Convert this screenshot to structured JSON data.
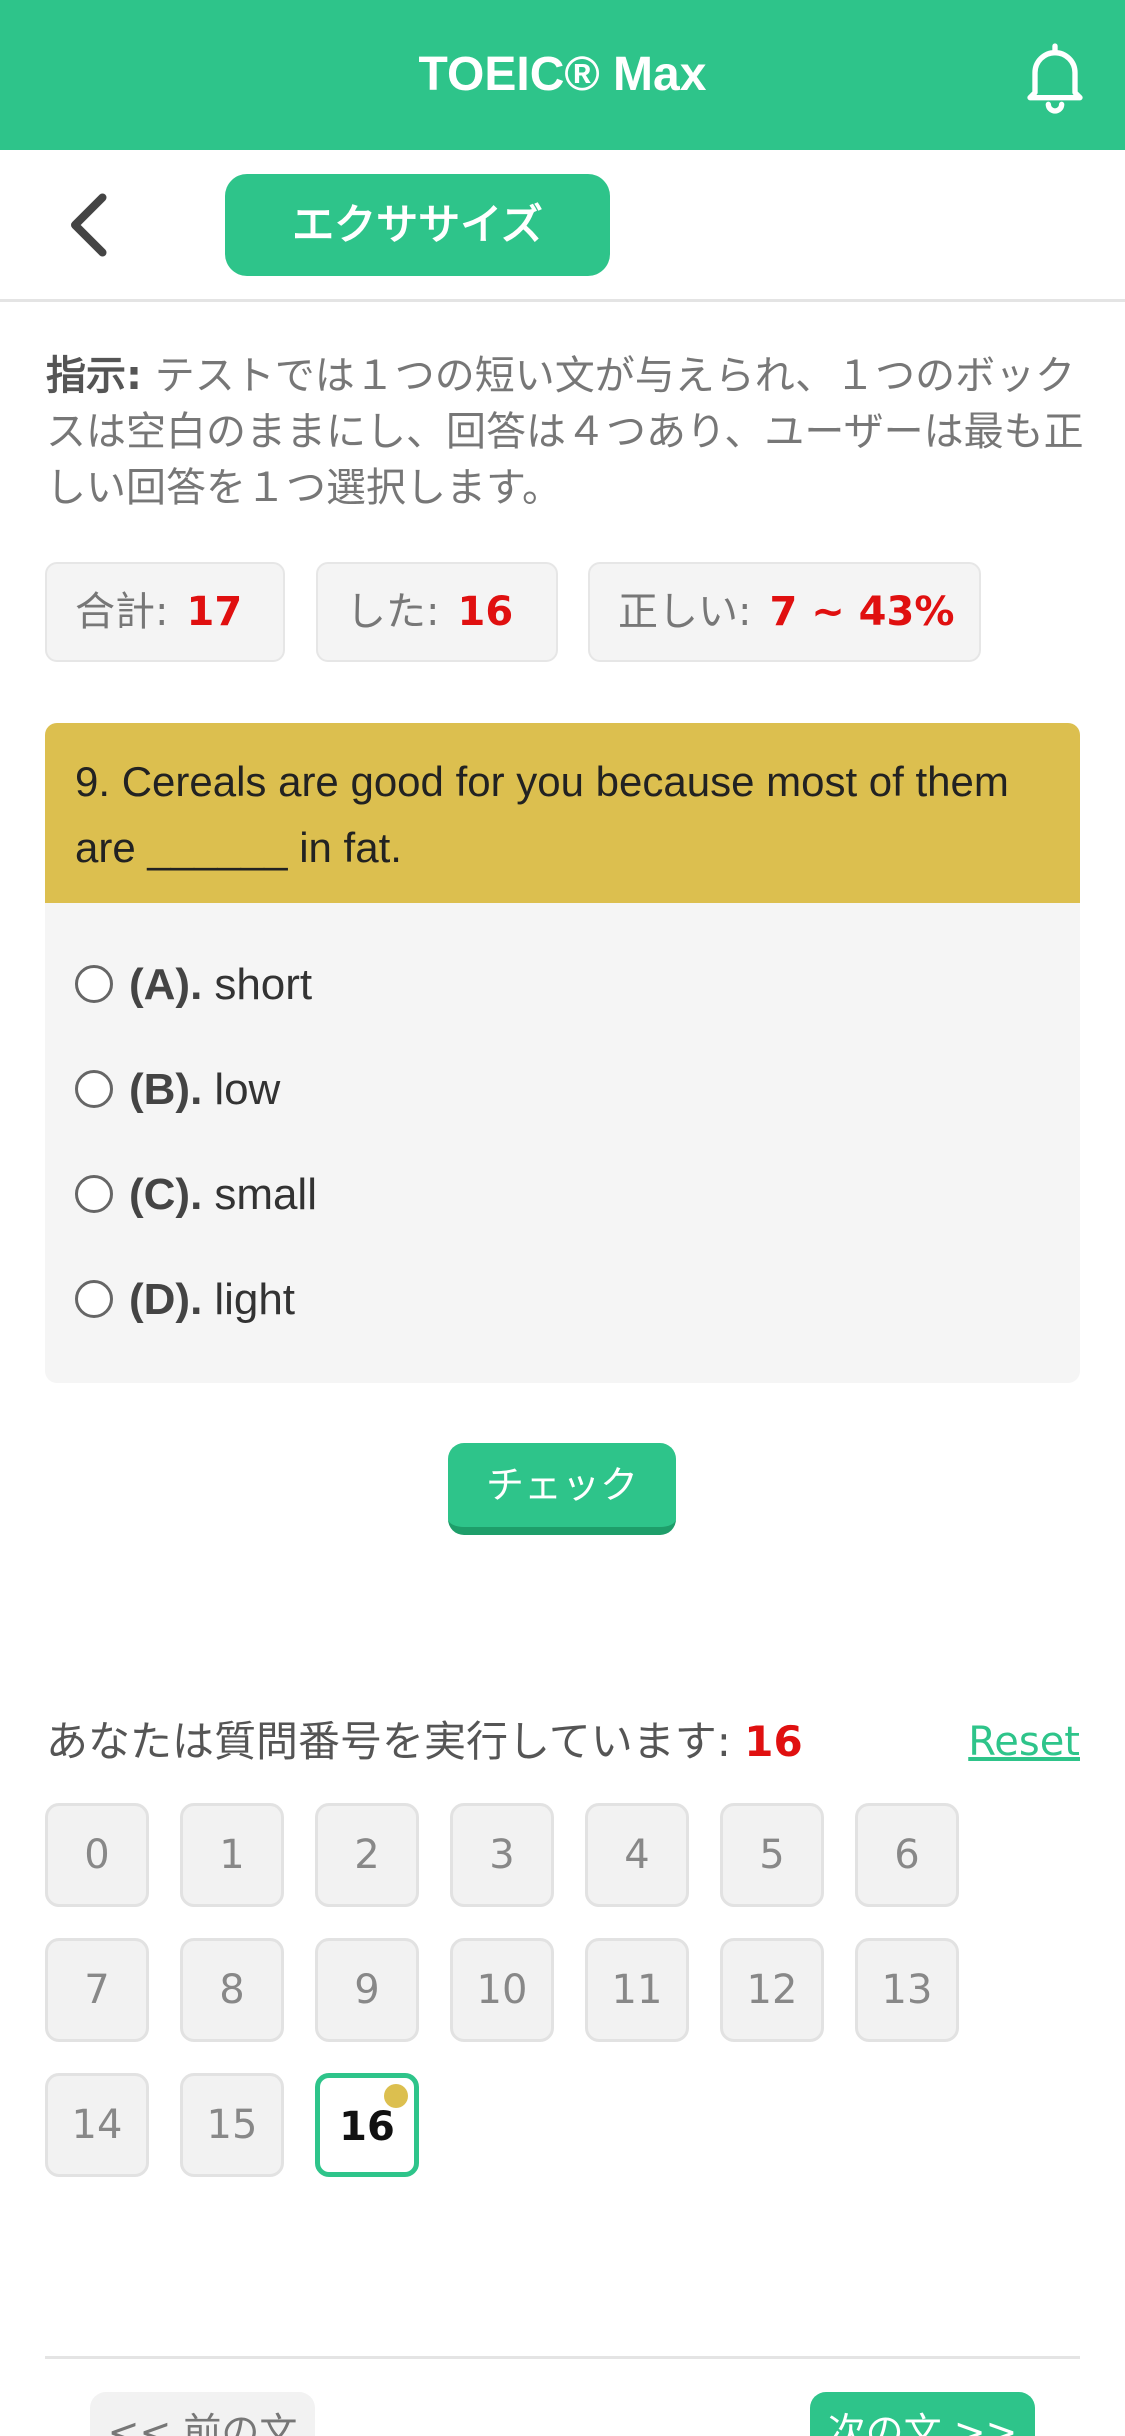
{
  "header": {
    "title": "TOEIC® Max",
    "bell_icon": "bell-icon"
  },
  "subheader": {
    "back_icon": "chevron-left-icon",
    "tab_label": "エクササイズ"
  },
  "instructions": {
    "label": "指示:",
    "text": " テストでは１つの短い文が与えられ、１つのボックスは空白のままにし、回答は４つあり、ユーザーは最も正しい回答を１つ選択します。"
  },
  "stats": {
    "total_label": "合計:",
    "total_value": "17",
    "done_label": "した:",
    "done_value": "16",
    "correct_label": "正しい:",
    "correct_value": "7 ~ 43%"
  },
  "question": {
    "text": "9. Cereals are good for you because most of them are ______ in fat.",
    "options": [
      {
        "letter": "(A).",
        "text": "short"
      },
      {
        "letter": "(B).",
        "text": "low"
      },
      {
        "letter": "(C).",
        "text": "small"
      },
      {
        "letter": "(D).",
        "text": "light"
      }
    ]
  },
  "check_label": "チェック",
  "progress": {
    "running_label": "あなたは質問番号を実行しています:",
    "current": "16",
    "reset_label": "Reset",
    "numbers": [
      "0",
      "1",
      "2",
      "3",
      "4",
      "5",
      "6",
      "7",
      "8",
      "9",
      "10",
      "11",
      "12",
      "13",
      "14",
      "15",
      "16"
    ]
  },
  "nav": {
    "prev_label": "<< 前の文",
    "next_label": "次の文 >>"
  },
  "colors": {
    "accent": "#2ec48a",
    "question_header": "#dcbf4f",
    "highlight_red": "#e01010"
  }
}
